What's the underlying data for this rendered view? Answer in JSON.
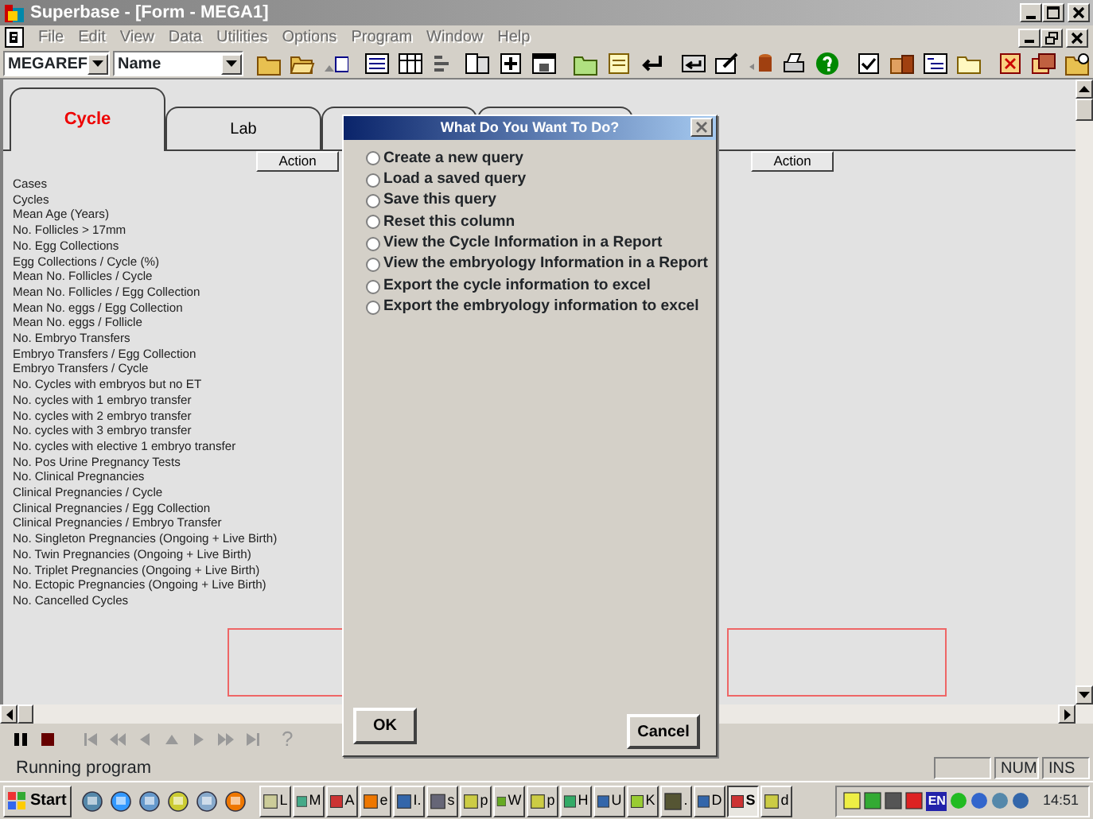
{
  "window": {
    "title": "Superbase - [Form - MEGA1]"
  },
  "menu": [
    {
      "label": "File",
      "disabled": true
    },
    {
      "label": "Edit",
      "disabled": true
    },
    {
      "label": "View",
      "disabled": true
    },
    {
      "label": "Data",
      "disabled": true
    },
    {
      "label": "Utilities",
      "disabled": true
    },
    {
      "label": "Options",
      "disabled": true
    },
    {
      "label": "Program",
      "disabled": true
    },
    {
      "label": "Window",
      "disabled": true
    },
    {
      "label": "Help",
      "disabled": true
    }
  ],
  "toolbar": {
    "file_combo": "MEGAREF",
    "field_combo": "Name"
  },
  "tabs": [
    {
      "label": "Cycle",
      "selected": true
    },
    {
      "label": "Lab",
      "selected": false
    },
    {
      "selected": false
    },
    {
      "selected": false
    }
  ],
  "action_buttons": [
    "Action",
    "Action"
  ],
  "rows": [
    "Cases",
    "Cycles",
    "Mean Age (Years)",
    "No. Follicles > 17mm",
    "No. Egg Collections",
    "Egg Collections / Cycle (%)",
    "Mean No. Follicles / Cycle",
    "Mean No. Follicles / Egg Collection",
    "Mean No. eggs / Egg Collection",
    "Mean No. eggs / Follicle",
    "No. Embryo Transfers",
    "Embryo Transfers / Egg Collection",
    "Embryo Transfers / Cycle",
    "No. Cycles with embryos but no ET",
    "No. cycles with 1 embryo transfer",
    "No. cycles with 2 embryo transfer",
    "No. cycles with 3 embryo transfer",
    "No. cycles with elective 1 embryo transfer",
    "No. Pos Urine Pregnancy Tests",
    "No. Clinical Pregnancies",
    "Clinical Pregnancies / Cycle",
    "Clinical Pregnancies / Egg Collection",
    "Clinical Pregnancies / Embryo Transfer",
    "No. Singleton Pregnancies (Ongoing + Live Birth)",
    "No. Twin Pregnancies (Ongoing + Live Birth)",
    "No. Triplet Pregnancies (Ongoing + Live Birth)",
    "No. Ectopic Pregnancies (Ongoing + Live Birth)",
    "No. Cancelled Cycles"
  ],
  "nav_bar": {
    "help": "?"
  },
  "status_bar": {
    "message": "Running program",
    "num": "NUM",
    "ins": "INS"
  },
  "dialog": {
    "title": "What Do You Want To Do?",
    "options": [
      {
        "label": "Create a new query",
        "selected": false
      },
      {
        "label": "Load a saved query",
        "selected": false
      },
      {
        "label": "Save this query",
        "selected": false
      },
      {
        "label": "Reset this column",
        "selected": false
      },
      {
        "label": "View the Cycle Information in a Report",
        "selected": false
      },
      {
        "label": "View the embryology Information in a Report",
        "selected": false
      },
      {
        "label": "Export the cycle information to excel",
        "selected": false
      },
      {
        "label": "Export the embryology information to excel",
        "selected": false
      }
    ],
    "ok": "OK",
    "cancel": "Cancel"
  },
  "taskbar": {
    "start": "Start",
    "tasks": [
      {
        "label": "L",
        "selected": false
      },
      {
        "label": "M",
        "selected": false
      },
      {
        "label": "A",
        "selected": false
      },
      {
        "label": "e",
        "selected": false
      },
      {
        "label": "I.",
        "selected": false
      },
      {
        "label": "s",
        "selected": false
      },
      {
        "label": "p",
        "selected": false
      },
      {
        "label": "W",
        "selected": false
      },
      {
        "label": "p",
        "selected": false
      },
      {
        "label": "H",
        "selected": false
      },
      {
        "label": "U",
        "selected": false
      },
      {
        "label": "K",
        "selected": false
      },
      {
        "label": ".",
        "selected": false
      },
      {
        "label": "D",
        "selected": false
      },
      {
        "label": "S",
        "selected": true
      },
      {
        "label": "d",
        "selected": false
      }
    ],
    "tray_lang": "EN",
    "clock": "14:51"
  }
}
